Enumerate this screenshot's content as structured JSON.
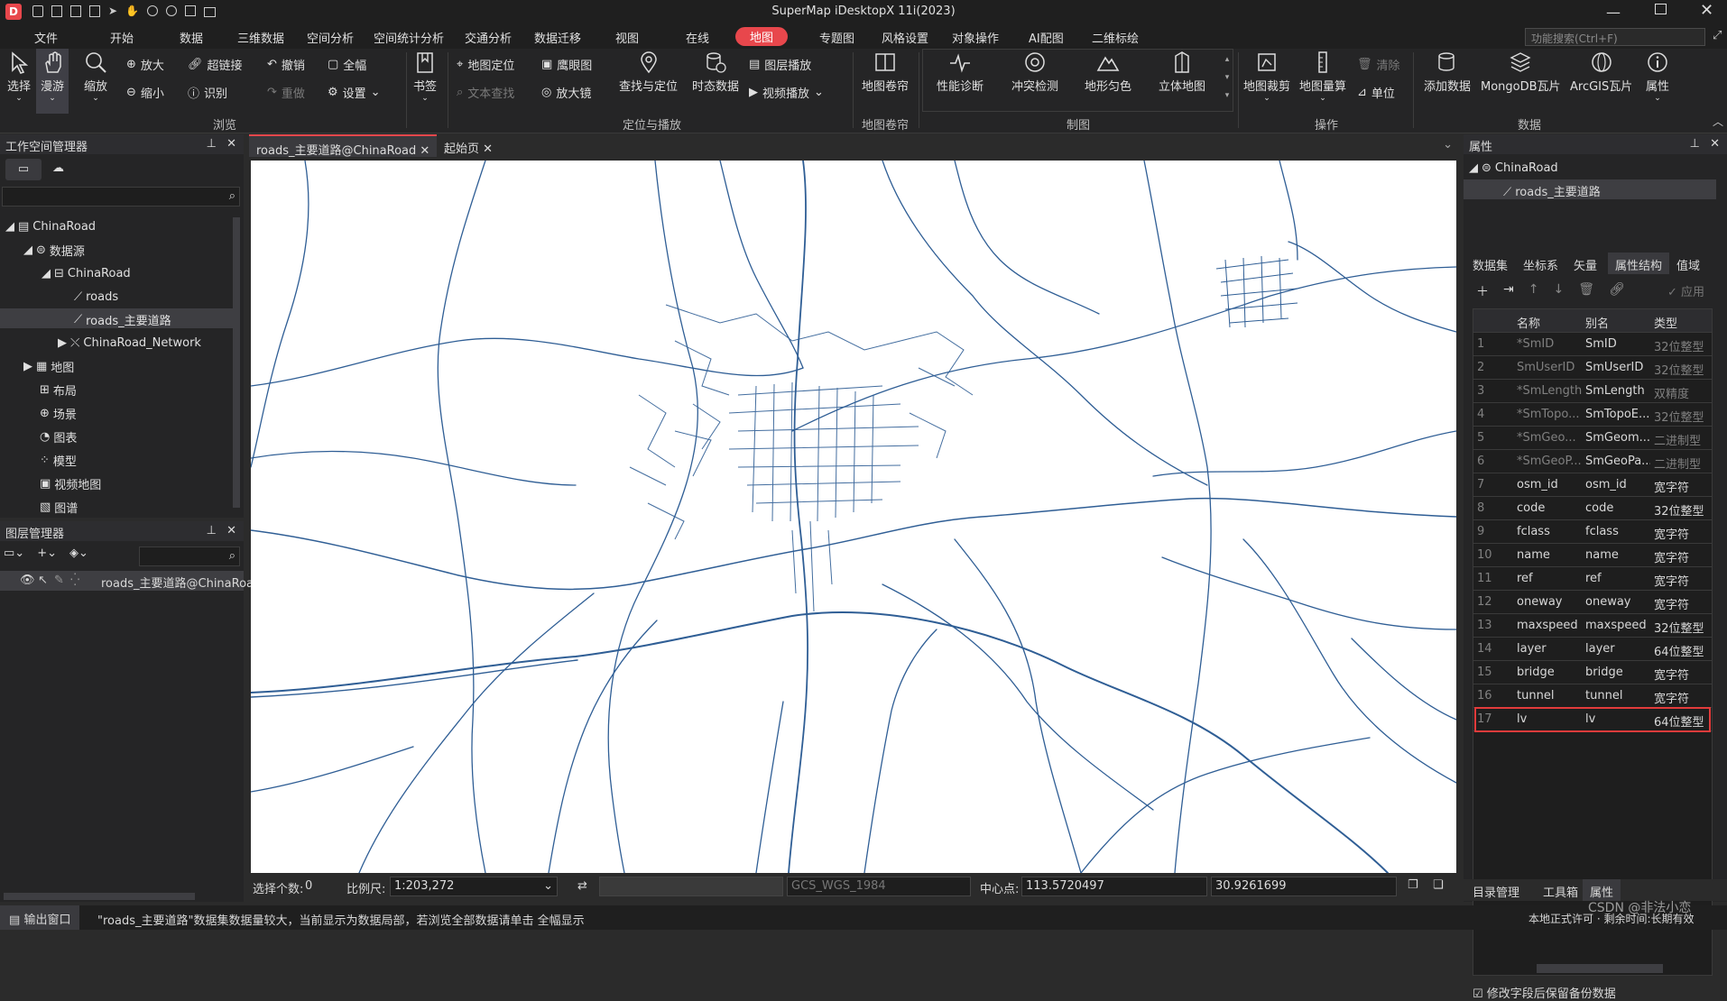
{
  "app_title": "SuperMap iDesktopX 11i(2023)",
  "menus": [
    "文件",
    "开始",
    "数据",
    "三维数据",
    "空间分析",
    "空间统计分析",
    "交通分析",
    "数据迁移",
    "视图",
    "在线",
    "地图",
    "专题图",
    "风格设置",
    "对象操作",
    "AI配图",
    "二维标绘"
  ],
  "menu_active": "地图",
  "search_placeholder": "功能搜索(Ctrl+F)",
  "ribbon": {
    "select": "选择",
    "pan": "漫游",
    "zoom": "缩放",
    "zoom_in": "放大",
    "zoom_out": "缩小",
    "hyperlink": "超链接",
    "identify": "识别",
    "undo": "撤销",
    "redo": "重做",
    "full": "全幅",
    "settings": "设置",
    "bookmark": "书签",
    "locate": "地图定位",
    "text_search": "文本查找",
    "eagle": "鹰眼图",
    "magnifier": "放大镜",
    "find_locate": "查找与定位",
    "temporal": "时态数据",
    "layer_play": "图层播放",
    "video_play": "视频播放",
    "map_roll": "地图卷帘",
    "perf": "性能诊断",
    "conflict": "冲突检测",
    "terrain": "地形匀色",
    "stereo": "立体地图",
    "clip": "地图裁剪",
    "measure": "地图量算",
    "clear": "清除",
    "unit": "单位",
    "add_data": "添加数据",
    "mongo": "MongoDB瓦片",
    "arcgis": "ArcGIS瓦片",
    "props": "属性",
    "groups": {
      "browse": "浏览",
      "locate_play": "定位与播放",
      "rollup": "地图卷帘",
      "mapping": "制图",
      "ops": "操作",
      "data": "数据"
    }
  },
  "workspace": {
    "title": "工作空间管理器",
    "root": "ChinaRoad",
    "datasources": "数据源",
    "ds": "ChinaRoad",
    "items": [
      "roads",
      "roads_主要道路",
      "ChinaRoad_Network"
    ],
    "others": [
      "地图",
      "布局",
      "场景",
      "图表",
      "模型",
      "视频地图",
      "图谱"
    ]
  },
  "layers": {
    "title": "图层管理器",
    "item": "roads_主要道路@ChinaRoad"
  },
  "tabs": {
    "map": "roads_主要道路@ChinaRoad",
    "start": "起始页"
  },
  "props": {
    "title": "属性",
    "root": "ChinaRoad",
    "dataset": "roads_主要道路",
    "tabs": [
      "数据集",
      "坐标系",
      "矢量",
      "属性结构",
      "值域"
    ],
    "active_tab": "属性结构",
    "apply": "应用",
    "headers": [
      "名称",
      "别名",
      "类型"
    ],
    "rows": [
      [
        "1",
        "*SmID",
        "SmID",
        "32位整型"
      ],
      [
        "2",
        "SmUserID",
        "SmUserID",
        "32位整型"
      ],
      [
        "3",
        "*SmLength",
        "SmLength",
        "双精度"
      ],
      [
        "4",
        "*SmTopo...",
        "SmTopoE...",
        "32位整型"
      ],
      [
        "5",
        "*SmGeo...",
        "SmGeom...",
        "二进制型"
      ],
      [
        "6",
        "*SmGeoP...",
        "SmGeoPa...",
        "二进制型"
      ],
      [
        "7",
        "osm_id",
        "osm_id",
        "宽字符"
      ],
      [
        "8",
        "code",
        "code",
        "32位整型"
      ],
      [
        "9",
        "fclass",
        "fclass",
        "宽字符"
      ],
      [
        "10",
        "name",
        "name",
        "宽字符"
      ],
      [
        "11",
        "ref",
        "ref",
        "宽字符"
      ],
      [
        "12",
        "oneway",
        "oneway",
        "宽字符"
      ],
      [
        "13",
        "maxspeed",
        "maxspeed",
        "32位整型"
      ],
      [
        "14",
        "layer",
        "layer",
        "64位整型"
      ],
      [
        "15",
        "bridge",
        "bridge",
        "宽字符"
      ],
      [
        "16",
        "tunnel",
        "tunnel",
        "宽字符"
      ],
      [
        "17",
        "lv",
        "lv",
        "64位整型"
      ]
    ],
    "backup_label": "修改字段后保留备份数据",
    "bottom_tabs": [
      "目录管理",
      "工具箱",
      "属性"
    ]
  },
  "status": {
    "sel_label": "选择个数:",
    "sel_count": "0",
    "scale_label": "比例尺:",
    "scale": "1:203,272",
    "crs": "GCS_WGS_1984",
    "center_label": "中心点:",
    "cx": "113.5720497",
    "cy": "30.9261699"
  },
  "output": {
    "label": "输出窗口",
    "message": "\"roads_主要道路\"数据集数据量较大，当前显示为数据局部，若浏览全部数据请单击 全幅显示",
    "right": "本地正式许可 · 剩余时间:长期有效",
    "watermark": "CSDN @非法小恋"
  },
  "colors": {
    "accent": "#e8474c",
    "road": "#2f5e95",
    "highlight": "#e23b3b"
  }
}
